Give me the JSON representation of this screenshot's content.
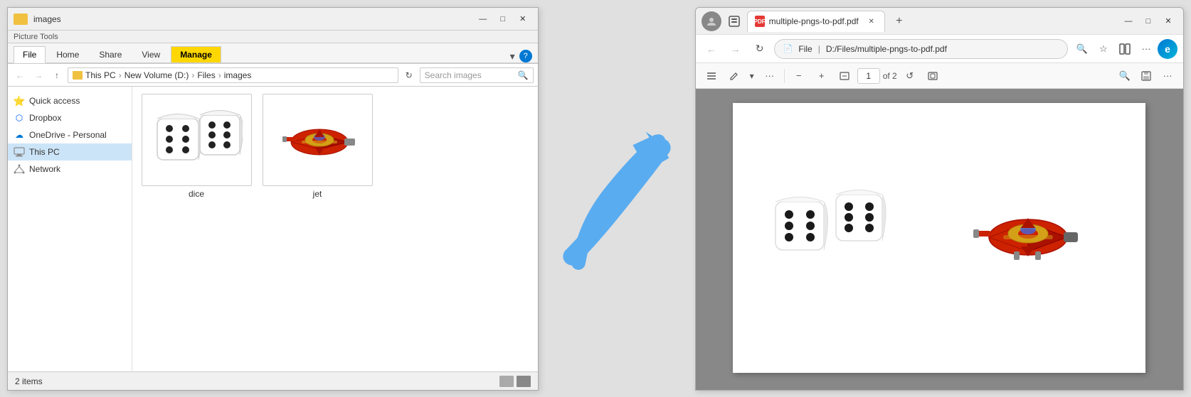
{
  "explorer": {
    "title": "images",
    "quick_access_pin": "📌",
    "tabs": [
      {
        "label": "File",
        "active": false,
        "class": "file-tab"
      },
      {
        "label": "Home",
        "active": false
      },
      {
        "label": "Share",
        "active": false
      },
      {
        "label": "View",
        "active": false
      },
      {
        "label": "Manage",
        "active": true,
        "manage": true
      }
    ],
    "picture_tools_label": "Picture Tools",
    "address_parts": [
      "This PC",
      "New Volume (D:)",
      "Files",
      "images"
    ],
    "search_placeholder": "Search images",
    "sidebar": [
      {
        "label": "Quick access",
        "icon": "star",
        "active": false
      },
      {
        "label": "Dropbox",
        "icon": "dropbox",
        "active": false
      },
      {
        "label": "OneDrive - Personal",
        "icon": "onedrive",
        "active": false
      },
      {
        "label": "This PC",
        "icon": "pc",
        "active": true
      },
      {
        "label": "Network",
        "icon": "network",
        "active": false
      }
    ],
    "files": [
      {
        "name": "dice",
        "type": "image"
      },
      {
        "name": "jet",
        "type": "image"
      }
    ],
    "status": "2 items",
    "window_controls": [
      "—",
      "□",
      "✕"
    ]
  },
  "browser": {
    "tab_label": "multiple-pngs-to-pdf.pdf",
    "url_file": "File",
    "url_path": "D:/Files/multiple-pngs-to-pdf.pdf",
    "page_current": "1",
    "page_total": "of 2",
    "window_controls": [
      "—",
      "□",
      "✕"
    ],
    "toolbar": {
      "minus": "−",
      "plus": "+",
      "rotate_left": "↺",
      "fit_page": "⊞"
    }
  },
  "arrow": {
    "color": "#5aacf0"
  }
}
